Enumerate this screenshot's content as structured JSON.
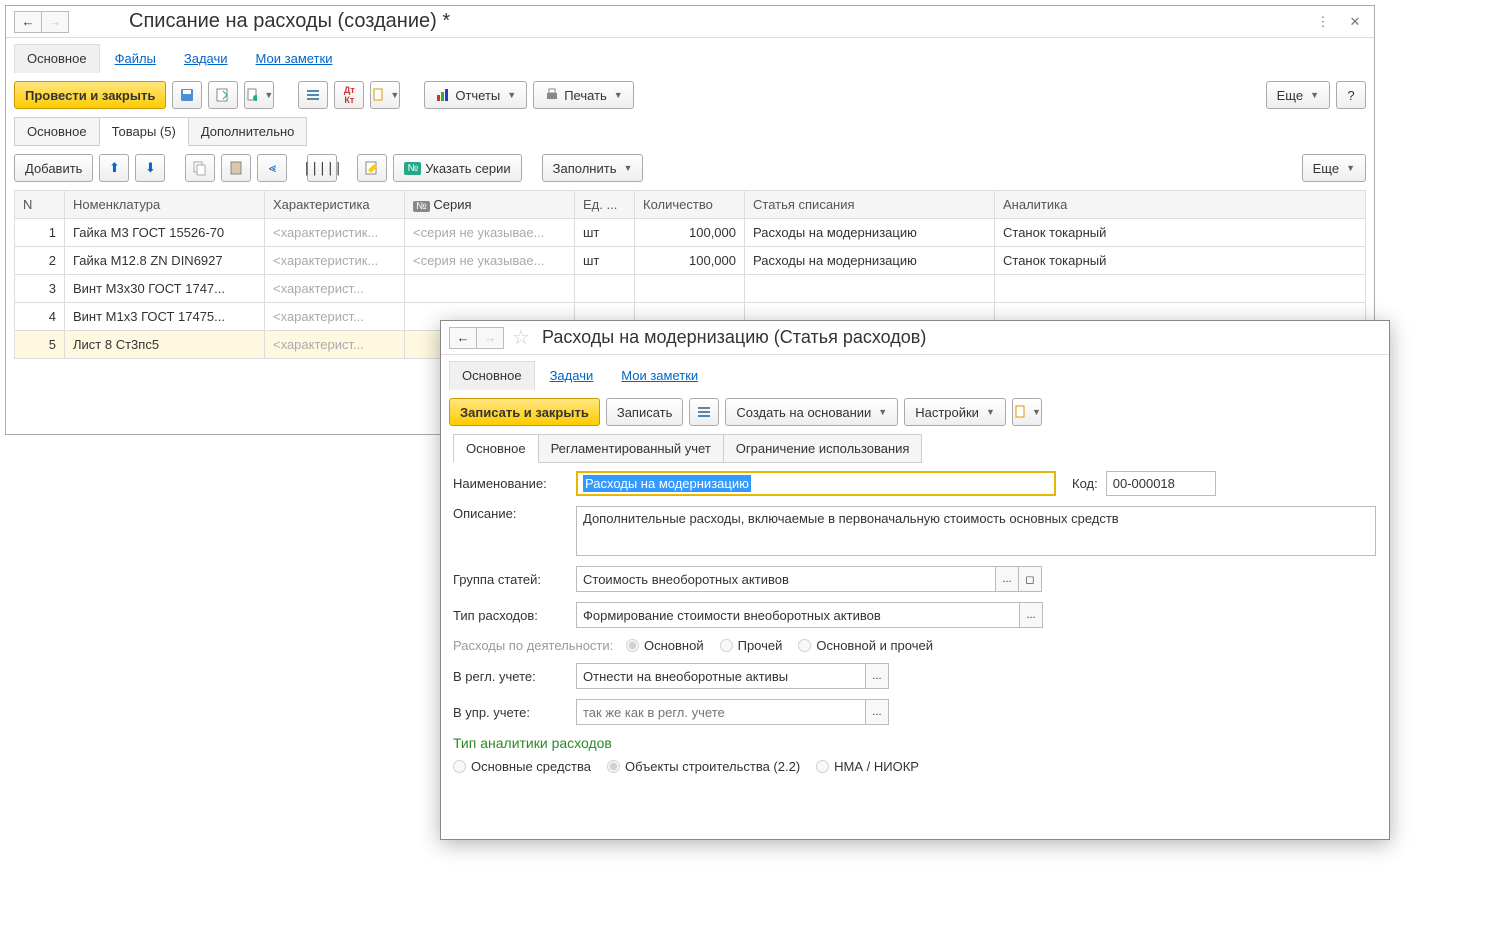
{
  "main": {
    "title": "Списание на расходы (создание) *",
    "sectionTabs": [
      "Основное",
      "Файлы",
      "Задачи",
      "Мои заметки"
    ],
    "toolbar": {
      "postAndClose": "Провести и закрыть",
      "reports": "Отчеты",
      "print": "Печать",
      "more": "Еще",
      "help": "?"
    },
    "contentTabs": [
      "Основное",
      "Товары (5)",
      "Дополнительно"
    ],
    "subToolbar": {
      "add": "Добавить",
      "series": "Указать серии",
      "fill": "Заполнить",
      "more": "Еще"
    },
    "table": {
      "headers": [
        "N",
        "Номенклатура",
        "Характеристика",
        "Серия",
        "Ед. ...",
        "Количество",
        "Статья списания",
        "Аналитика"
      ],
      "seriesPrefix": "№",
      "rows": [
        {
          "n": "1",
          "nom": "Гайка М3 ГОСТ 15526-70",
          "char": "<характеристик...",
          "ser": "<серия не указывае...",
          "unit": "шт",
          "qty": "100,000",
          "article": "Расходы на модернизацию",
          "analytics": "Станок токарный"
        },
        {
          "n": "2",
          "nom": "Гайка М12.8 ZN DIN6927",
          "char": "<характеристик...",
          "ser": "<серия не указывае...",
          "unit": "шт",
          "qty": "100,000",
          "article": "Расходы на модернизацию",
          "analytics": "Станок токарный"
        },
        {
          "n": "3",
          "nom": "Винт М3х30 ГОСТ 1747...",
          "char": "<характерист...",
          "ser": "",
          "unit": "",
          "qty": "",
          "article": "",
          "analytics": ""
        },
        {
          "n": "4",
          "nom": "Винт М1х3 ГОСТ 17475...",
          "char": "<характерист...",
          "ser": "",
          "unit": "",
          "qty": "",
          "article": "",
          "analytics": ""
        },
        {
          "n": "5",
          "nom": "Лист 8 Ст3пс5",
          "char": "<характерист...",
          "ser": "",
          "unit": "",
          "qty": "",
          "article": "",
          "analytics": ""
        }
      ]
    }
  },
  "modal": {
    "title": "Расходы на модернизацию (Статья расходов)",
    "sectionTabs": [
      "Основное",
      "Задачи",
      "Мои заметки"
    ],
    "toolbar": {
      "saveAndClose": "Записать и закрыть",
      "save": "Записать",
      "createBased": "Создать на основании",
      "settings": "Настройки"
    },
    "contentTabs": [
      "Основное",
      "Регламентированный учет",
      "Ограничение использования"
    ],
    "form": {
      "nameLabel": "Наименование:",
      "nameValue": "Расходы на модернизацию",
      "codeLabel": "Код:",
      "codeValue": "00-000018",
      "descLabel": "Описание:",
      "descValue": "Дополнительные расходы, включаемые в первоначальную стоимость основных средств",
      "groupLabel": "Группа статей:",
      "groupValue": "Стоимость внеоборотных активов",
      "typeLabel": "Тип расходов:",
      "typeValue": "Формирование стоимости внеоборотных активов",
      "activityLabel": "Расходы по деятельности:",
      "activityOpts": [
        "Основной",
        "Прочей",
        "Основной и прочей"
      ],
      "reglLabel": "В регл. учете:",
      "reglValue": "Отнести на внеоборотные активы",
      "mgmtLabel": "В упр. учете:",
      "mgmtPlaceholder": "так же как в регл. учете",
      "analyticsHeader": "Тип аналитики расходов",
      "analyticsOpts": [
        "Основные средства",
        "Объекты строительства (2.2)",
        "НМА / НИОКР"
      ]
    }
  }
}
